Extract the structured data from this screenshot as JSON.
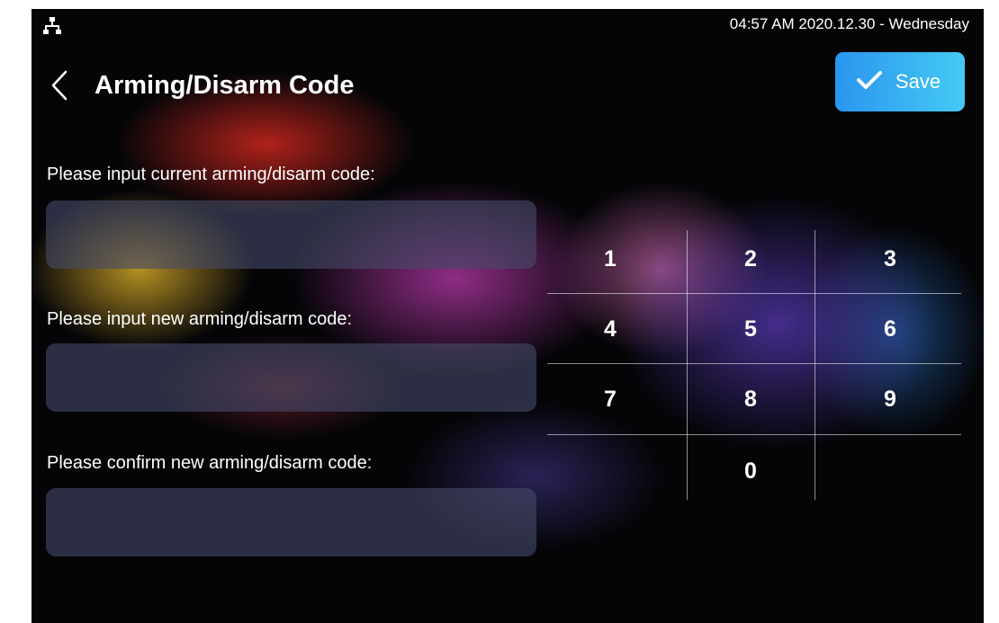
{
  "status_bar": {
    "network_icon": "network-topology-icon",
    "datetime": "04:57 AM  2020.12.30 - Wednesday"
  },
  "header": {
    "back_icon": "chevron-left-icon",
    "title": "Arming/Disarm Code",
    "save_icon": "checkmark-icon",
    "save_label": "Save"
  },
  "form": {
    "current_label": "Please input current arming/disarm code:",
    "current_value": "",
    "new_label": "Please input new arming/disarm code:",
    "new_value": "",
    "confirm_label": "Please confirm new arming/disarm code:",
    "confirm_value": ""
  },
  "keypad": {
    "keys": [
      "1",
      "2",
      "3",
      "4",
      "5",
      "6",
      "7",
      "8",
      "9",
      "0"
    ]
  },
  "colors": {
    "background": "#050508",
    "accent_start": "#2a96ef",
    "accent_end": "#45c9f3",
    "input_fill": "#464a68",
    "text": "#ffffff"
  }
}
